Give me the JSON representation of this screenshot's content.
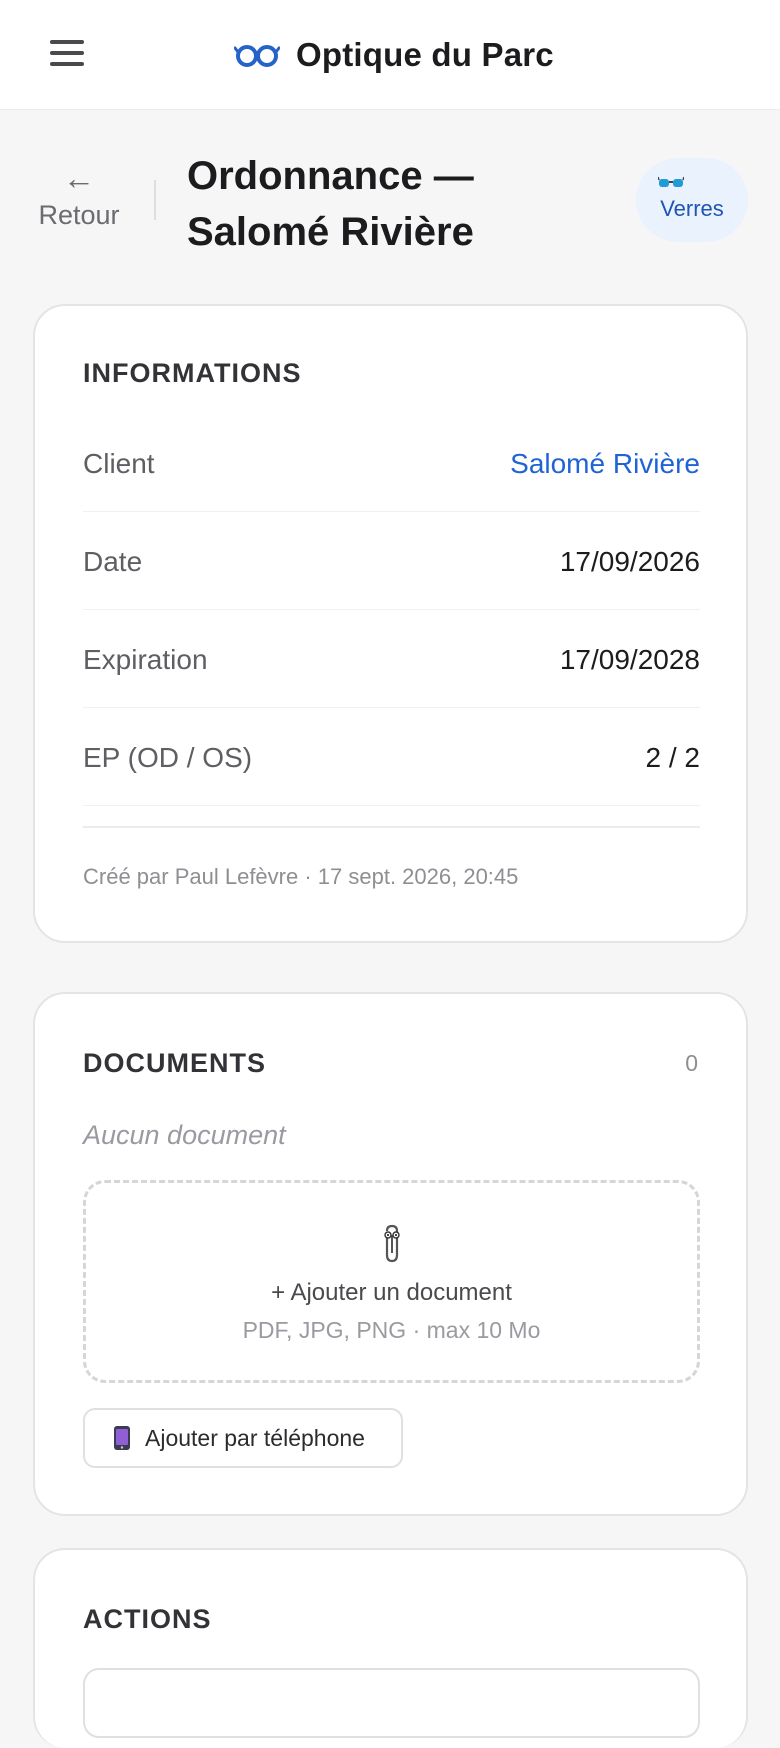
{
  "header": {
    "app_name": "Optique du Parc",
    "menu_icon": "hamburger-menu-icon",
    "brand_icon": "glasses-icon",
    "brand_color": "#2563c9"
  },
  "page": {
    "back_arrow": "←",
    "back_label": "Retour",
    "title": "Ordonnance — Salomé Rivière",
    "pill_label": "Verres",
    "pill_icon": "sunglasses-icon"
  },
  "informations": {
    "title": "INFORMATIONS",
    "rows": [
      {
        "label": "Client",
        "value": "Salomé Rivière"
      },
      {
        "label": "Date",
        "value": "17/09/2026"
      },
      {
        "label": "Expiration",
        "value": "17/09/2028"
      },
      {
        "label": "EP (OD / OS)",
        "value": "2 / 2"
      }
    ],
    "meta": "Créé par Paul Lefèvre · 17 sept. 2026, 20:45"
  },
  "documents": {
    "title": "DOCUMENTS",
    "count": "0",
    "empty_text": "Aucun document",
    "drop_icon": "paperclip-icon",
    "drop_main": "+ Ajouter un document",
    "drop_sub": "PDF, JPG, PNG · max 10 Mo",
    "phone_icon": "mobile-phone-icon",
    "phone_button": "Ajouter par téléphone"
  },
  "actions": {
    "title": "ACTIONS"
  },
  "colors": {
    "link": "#1f63d6",
    "accent_pill_bg": "#eaf2fd",
    "background": "#f6f6f7"
  }
}
